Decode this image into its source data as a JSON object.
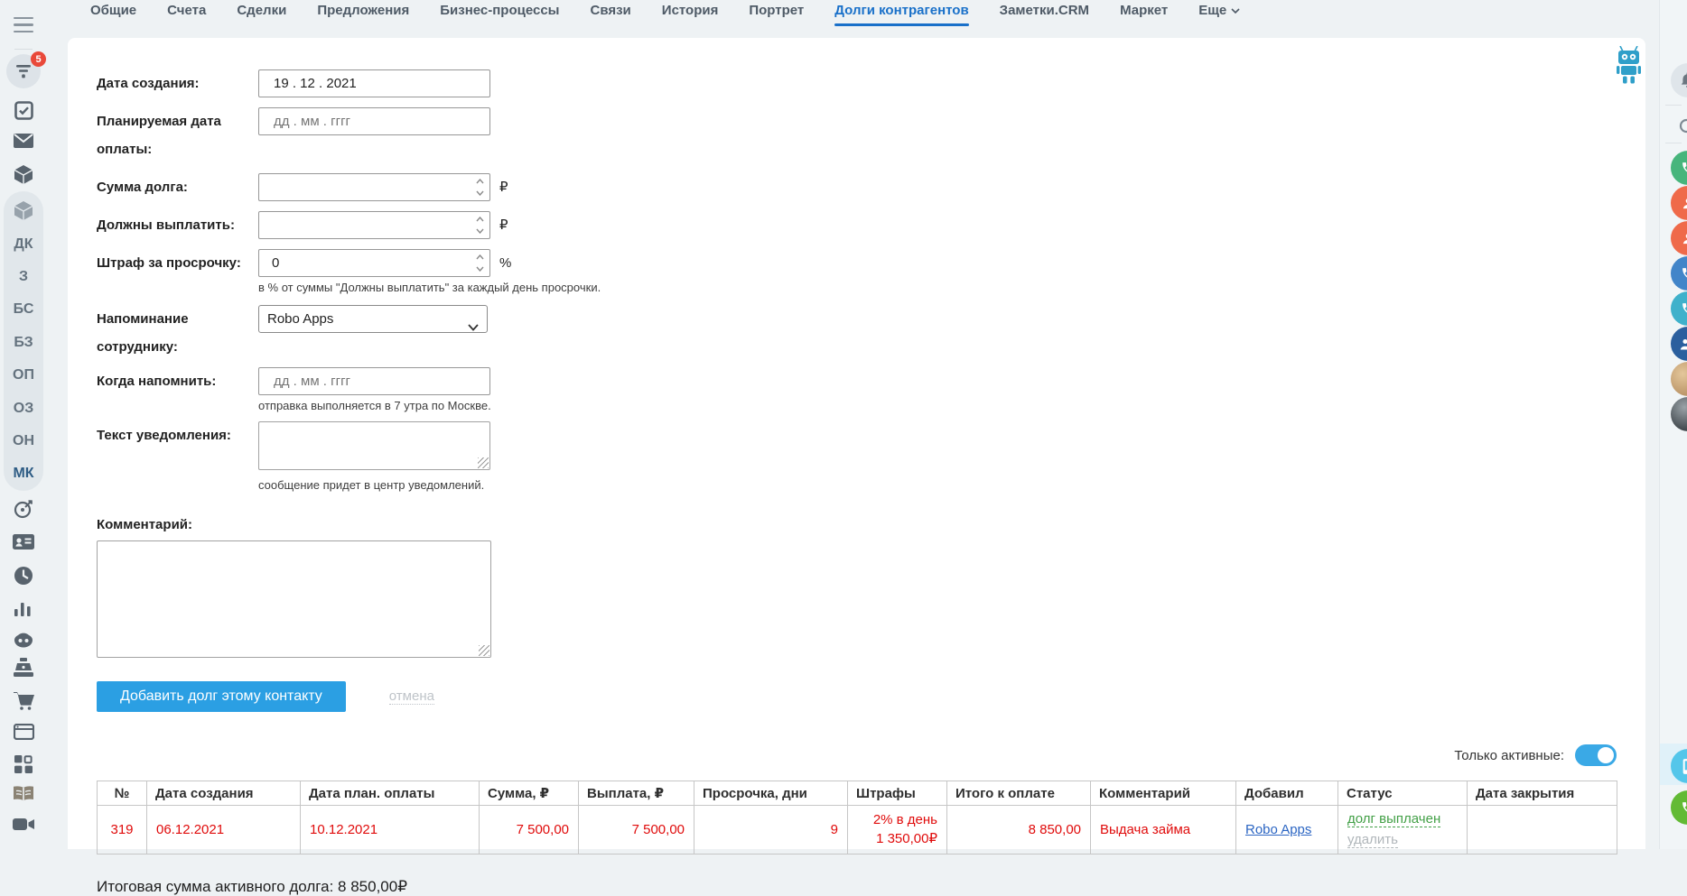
{
  "colors": {
    "accent_blue": "#1970c9",
    "button_blue": "#2b9fe3",
    "toggle_blue": "#3aa9e6",
    "row_red": "#e00b0b",
    "status_green": "#43a047",
    "badge_red": "#e9493a"
  },
  "tabs": {
    "labels": [
      "Общие",
      "Счета",
      "Сделки",
      "Предложения",
      "Бизнес-процессы",
      "Связи",
      "История",
      "Портрет",
      "Долги контрагентов",
      "Заметки.CRM",
      "Маркет",
      "Еще"
    ],
    "active": "Долги контрагентов"
  },
  "left_sidebar": {
    "badge_count": "5",
    "icons": [
      "hamburger-icon",
      "filter-icon",
      "checkbox-icon",
      "mail-icon",
      "cube-icon",
      "cube-icon",
      "target-icon",
      "id-card-icon",
      "clock-icon",
      "bar-chart-icon",
      "robot-head-icon",
      "cash-register-icon",
      "cart-icon",
      "window-icon",
      "grid-icon",
      "book-icon",
      "video-camera-icon"
    ],
    "letters": [
      "ДК",
      "З",
      "БС",
      "БЗ",
      "ОП",
      "ОЗ",
      "ОН",
      "МК"
    ]
  },
  "form": {
    "creation_date": {
      "label": "Дата создания:",
      "value": "19 . 12 . 2021"
    },
    "planned_date": {
      "label": "Планируемая дата оплаты:",
      "placeholder": "дд . мм . гггг"
    },
    "debt_amount": {
      "label": "Сумма долга:",
      "value": "",
      "unit": "₽"
    },
    "payout": {
      "label": "Должны выплатить:",
      "value": "",
      "unit": "₽"
    },
    "penalty": {
      "label": "Штраф за просрочку:",
      "value": "0",
      "unit": "%",
      "help": "в % от суммы \"Должны выплатить\" за каждый день просрочки."
    },
    "reminder_employee": {
      "label": "Напоминание сотруднику:",
      "value": "Robo Apps"
    },
    "reminder_date": {
      "label": "Когда напомнить:",
      "placeholder": "дд . мм . гггг",
      "help": "отправка выполняется в 7 утра по Москве."
    },
    "notification_text": {
      "label": "Текст уведомления:",
      "value": "",
      "help": "сообщение придет в центр уведомлений."
    },
    "comment": {
      "label": "Комментарий:",
      "value": ""
    },
    "submit_label": "Добавить долг этому контакту",
    "cancel_label": "отмена"
  },
  "filter": {
    "label": "Только активные:",
    "enabled": true
  },
  "table": {
    "headers": [
      "№",
      "Дата создания",
      "Дата план. оплаты",
      "Сумма, ₽",
      "Выплата, ₽",
      "Просрочка, дни",
      "Штрафы",
      "Итого к оплате",
      "Комментарий",
      "Добавил",
      "Статус",
      "Дата закрытия"
    ],
    "rows": [
      {
        "num": "319",
        "created": "06.12.2021",
        "planned": "10.12.2021",
        "amount": "7 500,00",
        "payout": "7 500,00",
        "overdue_days": "9",
        "penalty_rate": "2% в день",
        "penalty_sum": "1 350,00₽",
        "total": "8 850,00",
        "comment": "Выдача займа",
        "added_by": "Robo Apps",
        "status_paid": "долг выплачен",
        "status_delete": "удалить",
        "close_date": ""
      }
    ]
  },
  "summary": {
    "label": "Итоговая сумма активного долга: ",
    "value": "8 850,00₽"
  },
  "right_rail": {
    "icons": [
      "bell-icon",
      "search-icon",
      "phone-green-icon",
      "person-orange-icon",
      "person-orange-icon",
      "phone-blue-icon",
      "phone-teal-icon",
      "people-navy-icon",
      "avatar",
      "avatar",
      "device-lightblue-icon",
      "phone-lime-icon"
    ]
  }
}
